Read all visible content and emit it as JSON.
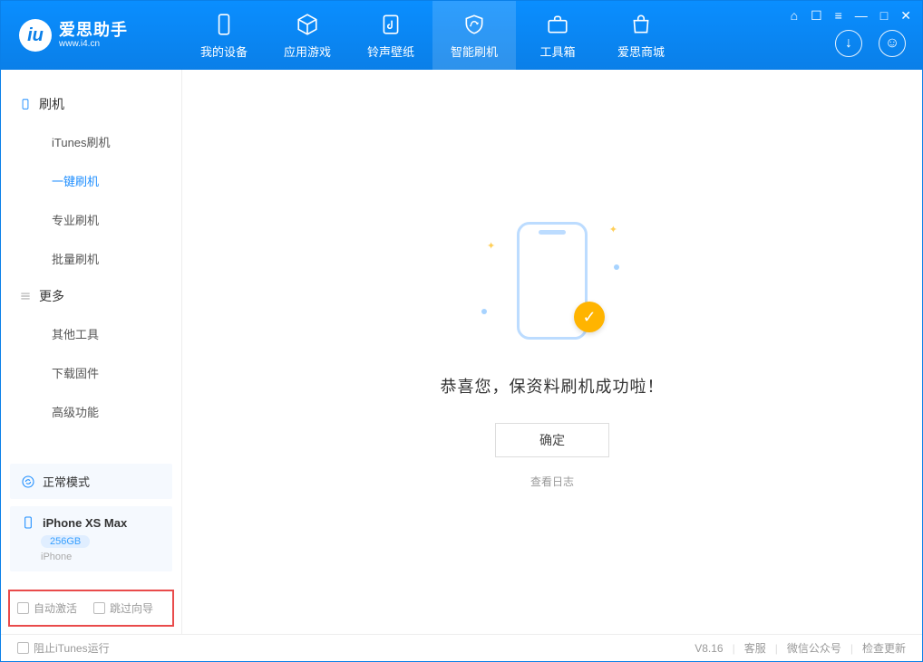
{
  "app": {
    "title": "爱思助手",
    "subtitle": "www.i4.cn"
  },
  "tabs": {
    "device": "我的设备",
    "apps": "应用游戏",
    "ringtone": "铃声壁纸",
    "flash": "智能刷机",
    "toolbox": "工具箱",
    "store": "爱思商城"
  },
  "sidebar": {
    "section1_title": "刷机",
    "items1": {
      "0": "iTunes刷机",
      "1": "一键刷机",
      "2": "专业刷机",
      "3": "批量刷机"
    },
    "section2_title": "更多",
    "items2": {
      "0": "其他工具",
      "1": "下载固件",
      "2": "高级功能"
    }
  },
  "device_cards": {
    "mode": "正常模式",
    "model": "iPhone XS Max",
    "storage": "256GB",
    "type": "iPhone"
  },
  "checkboxes": {
    "auto_activate": "自动激活",
    "skip_guide": "跳过向导"
  },
  "main": {
    "success_text": "恭喜您，保资料刷机成功啦！",
    "ok": "确定",
    "view_log": "查看日志"
  },
  "footer": {
    "block_itunes": "阻止iTunes运行",
    "version": "V8.16",
    "service": "客服",
    "wechat": "微信公众号",
    "update": "检查更新"
  }
}
